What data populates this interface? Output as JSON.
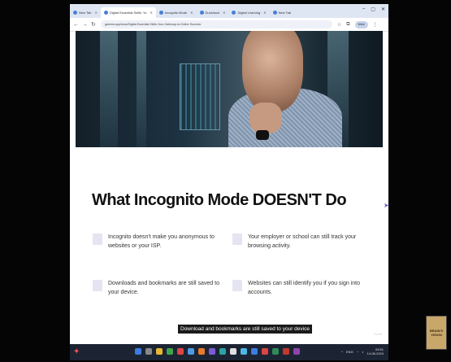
{
  "browser": {
    "tabs": [
      {
        "label": "New Tab",
        "active": false
      },
      {
        "label": "Digital Essential Skills: Yo",
        "active": true
      },
      {
        "label": "Incognito Mode",
        "active": false
      },
      {
        "label": "Duckduck",
        "active": false
      },
      {
        "label": "Digital Learning",
        "active": false
      },
      {
        "label": "New Tab",
        "active": false
      }
    ],
    "url": "gamma.app/docs/Digital-Essential-Skills-Your-Gateway-to-Online-Success",
    "profile_label": "Work"
  },
  "slide": {
    "title": "What Incognito Mode DOESN'T Do",
    "items": [
      {
        "text": "Incognito doesn't make you anonymous to websites or your ISP."
      },
      {
        "text": "Your employer or school can still track your browsing activity."
      },
      {
        "text": "Downloads and bookmarks are still saved to your device."
      },
      {
        "text": "Websites can still identify you if you sign into accounts."
      }
    ],
    "caption": "Download and bookmarks are still saved to your device"
  },
  "overlay": {
    "camera_label": "Zoom",
    "logo_text": "BRAIN'S VISION"
  },
  "taskbar": {
    "language": "ENG",
    "time": "09:51",
    "date": "14-08-2024"
  },
  "colors": {
    "tabbar": "#dfe6f3",
    "bullet": "#e4e4f2",
    "taskbar": "#1c2433"
  }
}
